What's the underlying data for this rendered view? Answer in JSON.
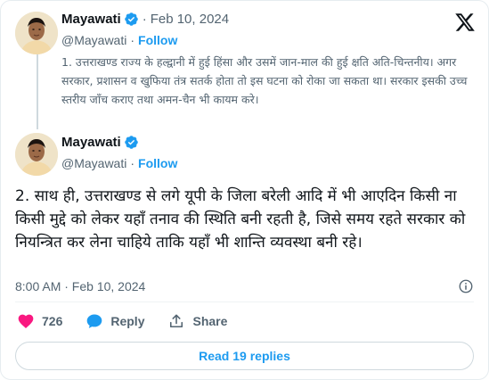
{
  "tweet1": {
    "name": "Mayawati",
    "handle": "@Mayawati",
    "separator": "·",
    "date": "Feb 10, 2024",
    "follow_label": "Follow",
    "text": "1. उत्तराखण्ड राज्य के हल्द्वानी में हुई हिंसा और उसमें जान-माल की हुई क्षति अति-चिन्तनीय। अगर सरकार, प्रशासन व खुफिया तंत्र सतर्क होता तो इस घटना को रोका जा सकता था। सरकार इसकी उच्च स्तरीय जाँच कराए तथा अमन-चैन भी कायम करे।"
  },
  "tweet2": {
    "name": "Mayawati",
    "handle": "@Mayawati",
    "separator": "·",
    "follow_label": "Follow",
    "text": "2. साथ ही, उत्तराखण्ड से लगे यूपी के जिला बरेली आदि में भी आएदिन किसी ना किसी मुद्दे को लेकर यहाँ तनाव की स्थिति बनी रहती है, जिसे समय रहते सरकार को नियन्त्रित कर लेना चाहिये ताकि यहाँ भी शान्ति व्यवस्था बनी रहे।",
    "timestamp": "8:00 AM · Feb 10, 2024"
  },
  "actions": {
    "like_count": "726",
    "reply_label": "Reply",
    "share_label": "Share"
  },
  "read_replies_label": "Read 19 replies",
  "icons": {
    "verified": "verified-badge-icon",
    "x_logo": "x-logo-icon",
    "info": "info-icon",
    "like": "heart-icon",
    "reply": "speech-bubble-icon",
    "share": "share-arrow-icon"
  },
  "colors": {
    "accent": "#1d9bf0",
    "like": "#f91880",
    "muted": "#536471",
    "text": "#0f1419"
  }
}
